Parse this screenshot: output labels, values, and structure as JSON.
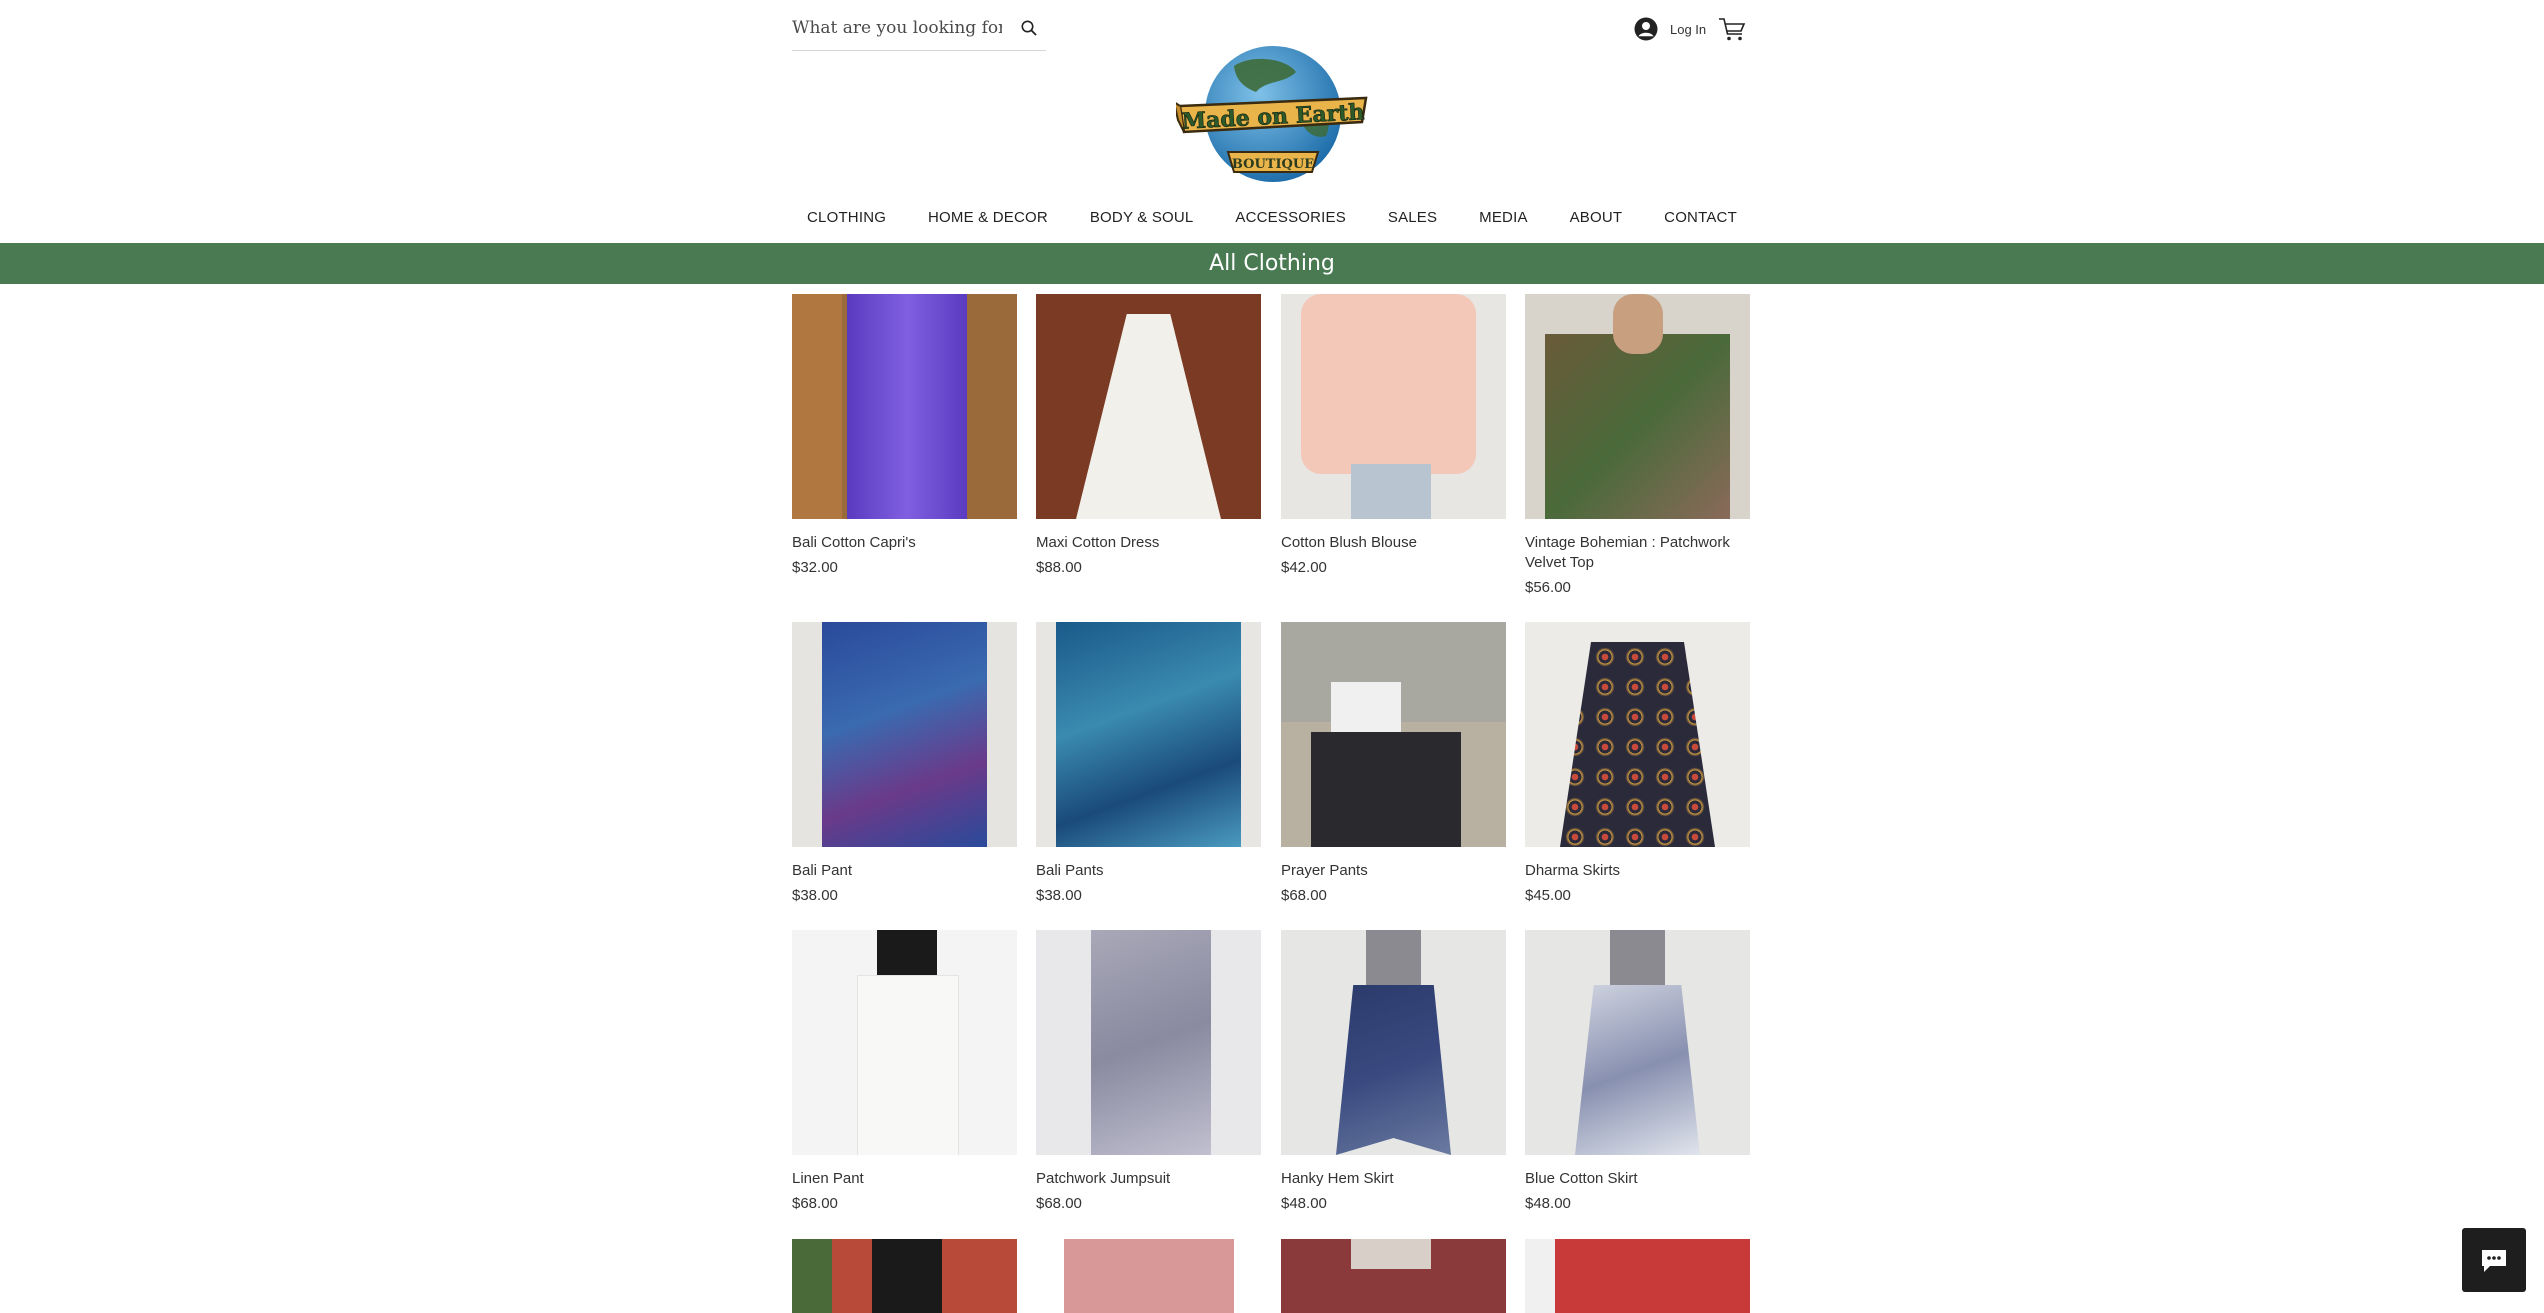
{
  "header": {
    "search_placeholder": "What are you looking for?",
    "login_label": "Log In",
    "logo_line1": "Made on Earth",
    "logo_line2": "BOUTIQUE"
  },
  "nav": {
    "items": [
      "CLOTHING",
      "HOME & DECOR",
      "BODY & SOUL",
      "ACCESSORIES",
      "SALES",
      "MEDIA",
      "ABOUT",
      "CONTACT"
    ]
  },
  "banner": {
    "title": "All Clothing"
  },
  "colors": {
    "accent": "#4a7a52"
  },
  "products": [
    {
      "name": "Bali Cotton Capri's",
      "price": "$32.00"
    },
    {
      "name": "Maxi Cotton Dress",
      "price": "$88.00"
    },
    {
      "name": "Cotton Blush Blouse",
      "price": "$42.00"
    },
    {
      "name": "Vintage Bohemian : Patchwork Velvet Top",
      "price": "$56.00"
    },
    {
      "name": "Bali Pant",
      "price": "$38.00"
    },
    {
      "name": "Bali Pants",
      "price": "$38.00"
    },
    {
      "name": "Prayer Pants",
      "price": "$68.00"
    },
    {
      "name": "Dharma Skirts",
      "price": "$45.00"
    },
    {
      "name": "Linen Pant",
      "price": "$68.00"
    },
    {
      "name": "Patchwork Jumpsuit",
      "price": "$68.00"
    },
    {
      "name": "Hanky Hem Skirt",
      "price": "$48.00"
    },
    {
      "name": "Blue Cotton Skirt",
      "price": "$48.00"
    }
  ],
  "icons": {
    "search": "search-icon",
    "login": "user-avatar-icon",
    "cart": "cart-icon",
    "chat": "chat-icon"
  }
}
